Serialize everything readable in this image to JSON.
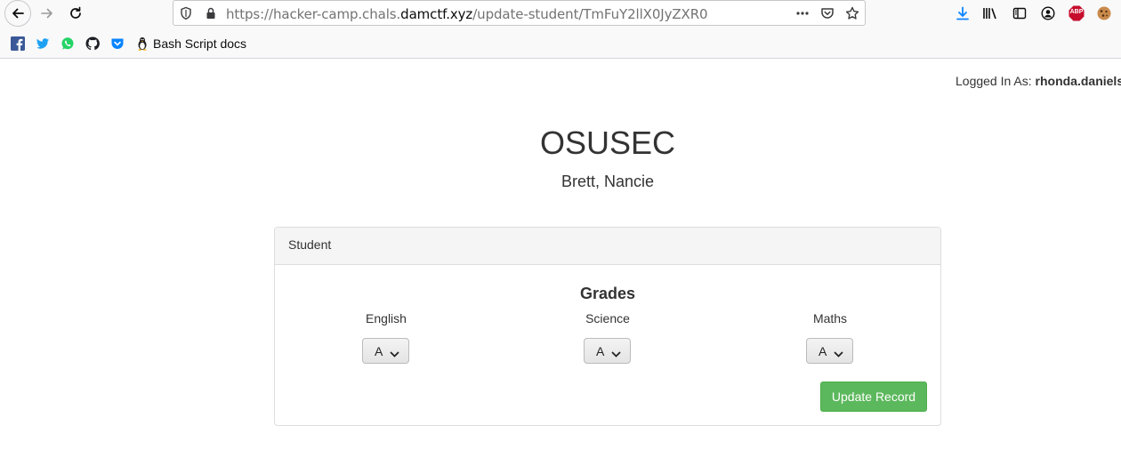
{
  "browser": {
    "url_prefix": "https://hacker-camp.chals.",
    "url_host": "damctf.xyz",
    "url_path": "/update-student/TmFuY2llX0JyZXR0",
    "bookmarks": [
      {
        "icon": "facebook-icon"
      },
      {
        "icon": "twitter-icon"
      },
      {
        "icon": "whatsapp-icon"
      },
      {
        "icon": "github-icon"
      },
      {
        "icon": "pocket-icon"
      },
      {
        "icon": "linux-icon",
        "label": "Bash Script docs"
      }
    ],
    "toolbar_icons": [
      "download-icon",
      "library-icon",
      "sidebar-icon",
      "account-icon",
      "adblock-icon",
      "cookie-icon"
    ],
    "abp_label": "ABP",
    "colors": {
      "download": "#0a84ff",
      "abp": "#c70d2c"
    }
  },
  "page": {
    "logged_in_prefix": "Logged In As:",
    "logged_in_user": "rhonda.daniels",
    "title": "OSUSEC",
    "student_name": "Brett, Nancie",
    "panel_heading": "Student",
    "grades_title": "Grades",
    "subjects": [
      {
        "label": "English",
        "grade": "A"
      },
      {
        "label": "Science",
        "grade": "A"
      },
      {
        "label": "Maths",
        "grade": "A"
      }
    ],
    "update_button": "Update Record",
    "colors": {
      "button": "#5cb85c"
    }
  }
}
